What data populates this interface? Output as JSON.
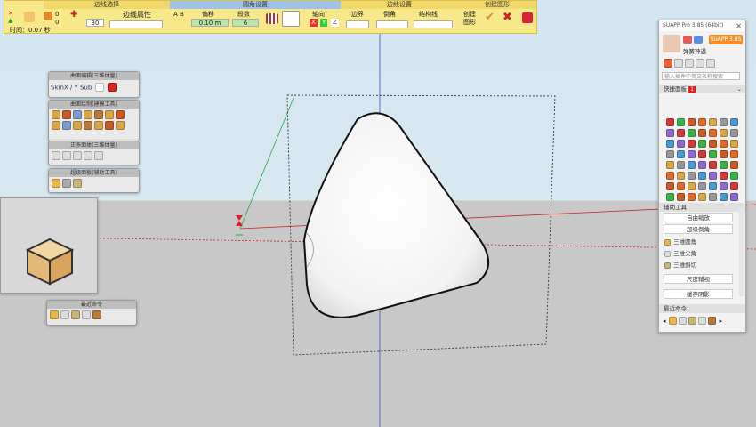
{
  "toolbar": {
    "edge_select": "边线选择",
    "fillet_settings": "圆角设置",
    "edge_settings": "边线设置",
    "create_shape": "创建图形",
    "edge_props": "边线属性",
    "offset_label": "偏移",
    "offset_value": "0.10 m",
    "segments_label": "段数",
    "segments_value": "6",
    "axis_label": "轴向",
    "axis_x": "X",
    "axis_y": "Y",
    "axis_z": "Z",
    "border_label": "边界",
    "chamfer_label": "倒角",
    "struct_label": "结构线",
    "create_label_1": "创建",
    "create_label_2": "图形",
    "ab_label": "A B",
    "num_30": "30",
    "num_0a": "0",
    "num_0b": "0",
    "time_label": "时间：0.07 秒"
  },
  "panels": {
    "p1_title": "曲面编辑(三维体量)",
    "p1_text": "SkinX / Y Sub",
    "p2_title": "曲面绘制(建模工具)",
    "p3_title": "正多面体(三维体量)",
    "p4_title": "超级面板(辅助工具)",
    "recent_title": "最近命令"
  },
  "suapp": {
    "title": "SUAPP Pro 3.85 (64bit)",
    "badge": "SUAPP 3.85",
    "user": "弹簧神遇",
    "search_placeholder": "输入插件中英文名称搜索",
    "quick_panel": "快捷面板",
    "quick_badge": "1",
    "aux_tools": "辅助工具",
    "back_zoom": "自由缩放",
    "super_chamfer": "超级倒角",
    "item1": "三维圆角",
    "item2": "三维尖角",
    "item3": "三维斜切",
    "dim_aux": "尺度辅视",
    "cache_shadow": "缓存阴影",
    "recent_cmd": "最近命令"
  },
  "colors": {
    "toolbar_bg": "#f7e88a",
    "sky": "#d3e6f2",
    "ground": "#c8c8c8",
    "axis_red": "#cc2222",
    "axis_blue": "#3355bb",
    "axis_green": "#22aa44",
    "accent_orange": "#f0902a"
  }
}
